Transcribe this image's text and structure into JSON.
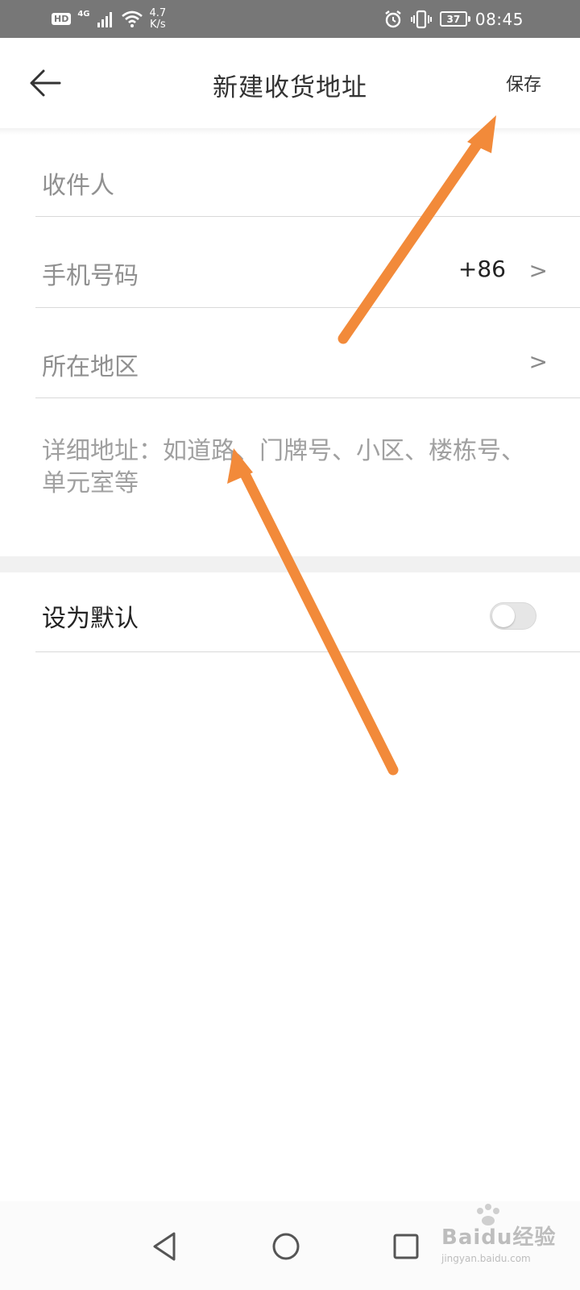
{
  "status_bar": {
    "hd": "HD",
    "network": "4G",
    "speed_value": "4.7",
    "speed_unit": "K/s",
    "battery": "37",
    "time": "08:45"
  },
  "header": {
    "title": "新建收货地址",
    "save_label": "保存"
  },
  "form": {
    "recipient_placeholder": "收件人",
    "phone_placeholder": "手机号码",
    "country_code": "+86",
    "region_placeholder": "所在地区",
    "chevron": ">",
    "address_placeholder": "详细地址：如道路、门牌号、小区、楼栋号、单元室等"
  },
  "default_setting": {
    "label": "设为默认",
    "enabled": false
  },
  "watermark": {
    "brand": "Baidu经验",
    "url": "jingyan.baidu.com"
  },
  "colors": {
    "status_bar": "#777777",
    "arrow": "#f28a3a",
    "divider": "#d9d9d9"
  }
}
